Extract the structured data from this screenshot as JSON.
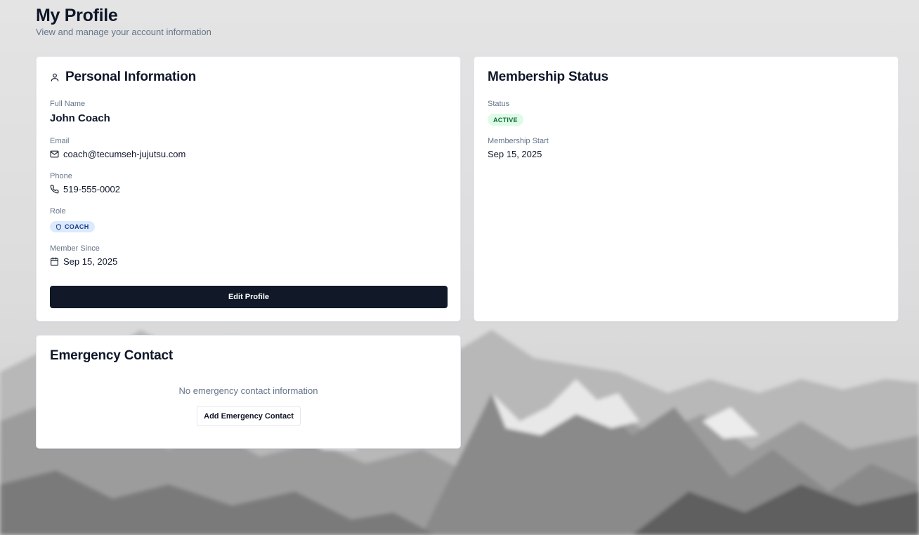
{
  "header": {
    "title": "My Profile",
    "subtitle": "View and manage your account information"
  },
  "personal": {
    "title": "Personal Information",
    "title_icon": "user-icon",
    "full_name_label": "Full Name",
    "full_name": "John Coach",
    "email_label": "Email",
    "email": "coach@tecumseh-jujutsu.com",
    "email_icon": "mail-icon",
    "phone_label": "Phone",
    "phone": "519-555-0002",
    "phone_icon": "phone-icon",
    "role_label": "Role",
    "role": "COACH",
    "role_icon": "shield-icon",
    "member_since_label": "Member Since",
    "member_since": "Sep 15, 2025",
    "member_since_icon": "calendar-icon",
    "edit_button": "Edit Profile"
  },
  "membership": {
    "title": "Membership Status",
    "status_label": "Status",
    "status": "ACTIVE",
    "start_label": "Membership Start",
    "start": "Sep 15, 2025"
  },
  "emergency": {
    "title": "Emergency Contact",
    "empty_text": "No emergency contact information",
    "add_button": "Add Emergency Contact"
  },
  "colors": {
    "primary_button": "#111827",
    "role_badge_bg": "#dbeafe",
    "status_badge_bg": "#dcfce7",
    "muted_text": "#64748b"
  }
}
